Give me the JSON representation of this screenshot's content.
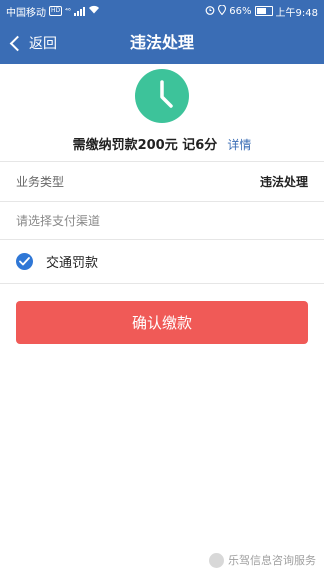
{
  "status_bar": {
    "carrier": "中国移动",
    "network_badge": "HD",
    "network_type": "⁴⁶",
    "battery": "66%",
    "time": "上午9:48",
    "icons": [
      "wifi-icon",
      "signal-icon",
      "alarm-icon",
      "location-icon",
      "battery-icon"
    ]
  },
  "navbar": {
    "back_label": "返回",
    "title": "违法处理",
    "background": "#3a6db5"
  },
  "summary": {
    "icon": "clock-icon",
    "icon_color": "#3dc39a",
    "fine_text": "需缴纳罚款200元 记6分",
    "detail_link": "详情"
  },
  "business": {
    "label": "业务类型",
    "value": "违法处理"
  },
  "payment": {
    "hint": "请选择支付渠道",
    "option_label": "交通罚款",
    "option_checked": true,
    "accent": "#2f77d6"
  },
  "actions": {
    "confirm_label": "确认缴款",
    "confirm_color": "#f05a57"
  },
  "watermark": {
    "text": "乐驾信息咨询服务"
  }
}
